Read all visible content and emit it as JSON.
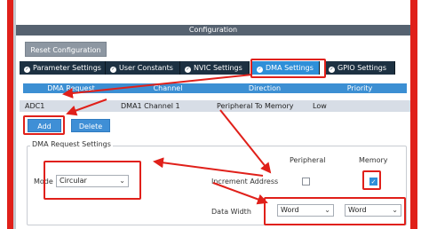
{
  "config_title": "Configuration",
  "reset_button": "Reset Configuration",
  "tabs": [
    {
      "label": "Parameter Settings",
      "active": false
    },
    {
      "label": "User Constants",
      "active": false
    },
    {
      "label": "NVIC Settings",
      "active": false
    },
    {
      "label": "DMA Settings",
      "active": true
    },
    {
      "label": "GPIO Settings",
      "active": false
    }
  ],
  "table": {
    "headers": [
      "DMA Request",
      "Channel",
      "Direction",
      "Priority"
    ],
    "rows": [
      [
        "ADC1",
        "DMA1 Channel 1",
        "Peripheral To Memory",
        "Low"
      ]
    ]
  },
  "buttons": {
    "add": "Add",
    "delete": "Delete"
  },
  "settings": {
    "legend": "DMA Request Settings",
    "mode_label": "Mode",
    "mode_value": "Circular",
    "col_peripheral": "Peripheral",
    "col_memory": "Memory",
    "increment_label": "Increment Address",
    "increment_peripheral": false,
    "increment_memory": true,
    "data_width_label": "Data Width",
    "data_width_peripheral": "Word",
    "data_width_memory": "Word"
  },
  "colors": {
    "annotation": "#e0201a",
    "active_tab": "#2f8fd8",
    "tab_bg": "#1d3142",
    "header_bg": "#3c8fd3"
  }
}
